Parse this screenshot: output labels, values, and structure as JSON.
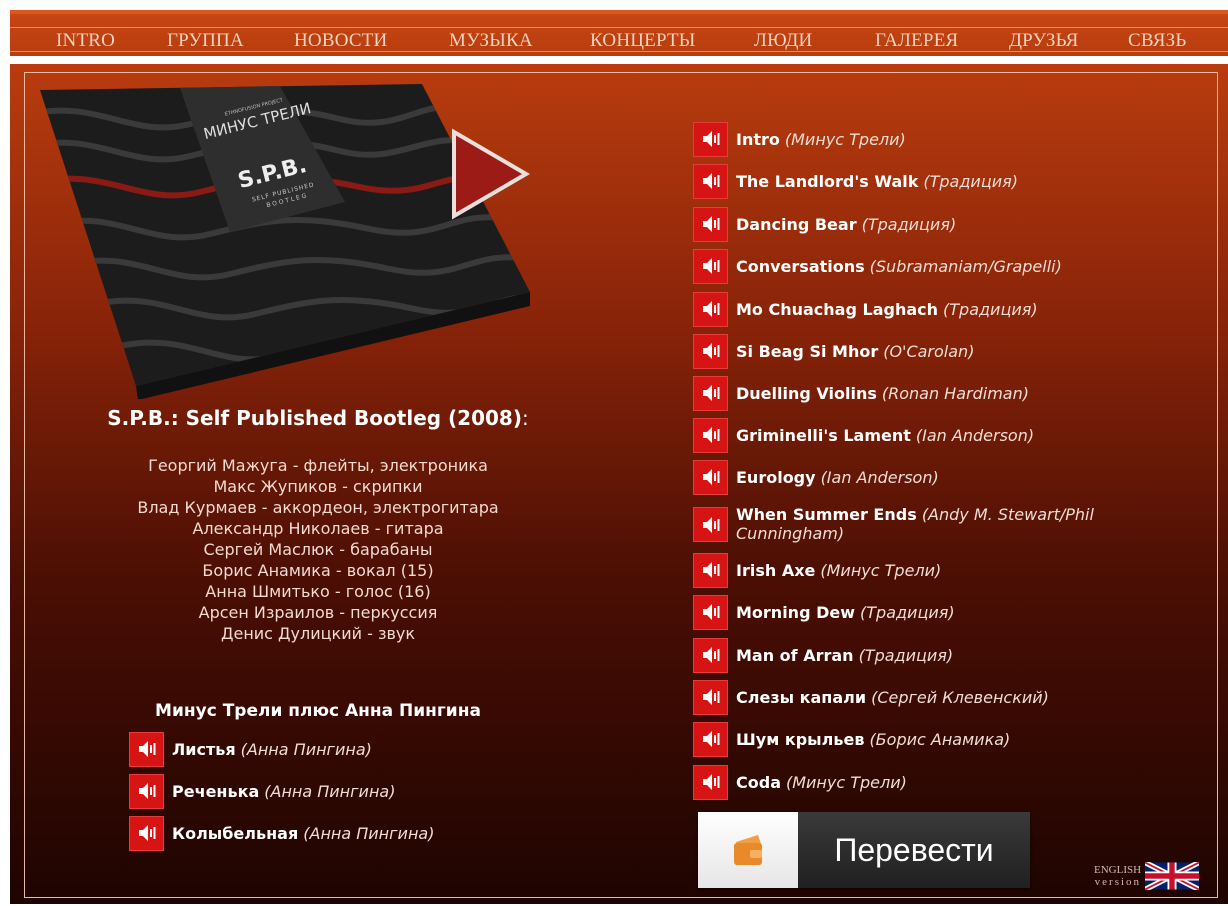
{
  "nav": {
    "items": [
      "INTRO",
      "ГРУППА",
      "НОВОСТИ",
      "МУЗЫКА",
      "КОНЦЕРТЫ",
      "ЛЮДИ",
      "ГАЛЕРЕЯ",
      "ДРУЗЬЯ",
      "СВЯЗЬ"
    ]
  },
  "album": {
    "cover": {
      "band_logo": "МИНУС ТРЕЛИ",
      "logo_small_text": "ETHNOFUSION PROJECT",
      "title_text": "S.P.B.",
      "subtitle_line1": "SELF PUBLISHED",
      "subtitle_line2": "BOOTLEG"
    },
    "title": "S.P.B.: Self Published Bootleg (2008)",
    "title_colon": ":",
    "members": [
      "Георгий Мажуга - флейты, электроника",
      "Макс Жупиков - скрипки",
      "Влад Курмаев - аккордеон, электрогитара",
      "Александр Николаев - гитара",
      "Сергей Маслюк - барабаны",
      "Борис Анамика - вокал (15)",
      "Анна Шмитько - голос (16)",
      "Арсен Израилов - перкуссия",
      "Денис Дулицкий - звук"
    ]
  },
  "bonus": {
    "title": "Минус Трели плюс Анна Пингина",
    "tracks": [
      {
        "name": "Листья",
        "author": "(Анна Пингина)"
      },
      {
        "name": "Реченька",
        "author": "(Анна Пингина)"
      },
      {
        "name": "Колыбельная",
        "author": "(Анна Пингина)"
      }
    ]
  },
  "tracklist": [
    {
      "name": "Intro",
      "author": "(Минус Трели)"
    },
    {
      "name": "The Landlord's Walk",
      "author": "(Традиция)"
    },
    {
      "name": "Dancing Bear",
      "author": "(Традиция)"
    },
    {
      "name": "Conversations",
      "author": "(Subramaniam/Grapelli)"
    },
    {
      "name": "Mo Chuachag Laghach",
      "author": "(Традиция)"
    },
    {
      "name": "Si Beag Si Mhor",
      "author": "(O'Carolan)"
    },
    {
      "name": "Duelling Violins",
      "author": "(Ronan Hardiman)"
    },
    {
      "name": "Griminelli's Lament",
      "author": "(Ian Anderson)"
    },
    {
      "name": "Eurology",
      "author": "(Ian Anderson)"
    },
    {
      "name": "When Summer Ends",
      "author": "(Andy M. Stewart/Phil Cunningham)"
    },
    {
      "name": "Irish Axe",
      "author": "(Минус Трели)"
    },
    {
      "name": "Morning Dew",
      "author": "(Традиция)"
    },
    {
      "name": "Man of Arran",
      "author": "(Традиция)"
    },
    {
      "name": "Слезы капали",
      "author": "(Сергей Клевенский)"
    },
    {
      "name": "Шум крыльев",
      "author": "(Борис Анамика)"
    },
    {
      "name": "Coda",
      "author": "(Минус Трели)"
    }
  ],
  "translate": {
    "label": "Перевести"
  },
  "english": {
    "line1": "ENGLISH",
    "line2": "version"
  },
  "colors": {
    "accent": "#d61414",
    "nav_bg": "#c64512",
    "panel_top": "#b93c0e",
    "panel_bottom": "#1e0401"
  },
  "icons": {
    "track": "speaker-icon",
    "play": "play-icon",
    "translate": "wallet-icon",
    "english": "uk-flag-icon"
  }
}
